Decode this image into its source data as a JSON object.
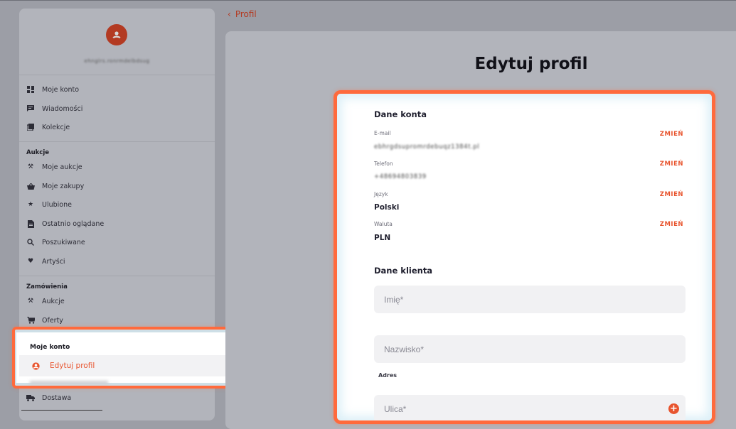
{
  "sidebar": {
    "email": "ehnglrs.ronrmdelbdsug",
    "items_top": [
      {
        "label": "Moje konto",
        "icon": "dashboard-icon"
      },
      {
        "label": "Wiadomości",
        "icon": "message-icon"
      },
      {
        "label": "Kolekcje",
        "icon": "collection-icon"
      }
    ],
    "auctions_title": "Aukcje",
    "items_auctions": [
      {
        "label": "Moje aukcje",
        "icon": "gavel-icon"
      },
      {
        "label": "Moje zakupy",
        "icon": "basket-icon"
      },
      {
        "label": "Ulubione",
        "icon": "star-icon"
      },
      {
        "label": "Ostatnio oglądane",
        "icon": "document-icon"
      },
      {
        "label": "Poszukiwane",
        "icon": "search-icon"
      },
      {
        "label": "Artyści",
        "icon": "heart-icon"
      }
    ],
    "orders_title": "Zamówienia",
    "items_orders": [
      {
        "label": "Aukcje",
        "icon": "gavel-icon"
      },
      {
        "label": "Oferty",
        "icon": "cart-icon"
      }
    ],
    "account_title": "Moje konto",
    "account_active": "Edytuj profil",
    "items_after": [
      {
        "label": "Dostawa",
        "icon": "truck-icon"
      }
    ]
  },
  "back_link": "Profil",
  "page_title": "Edytuj profil",
  "account_section": {
    "title": "Dane konta",
    "change_label": "ZMIEŃ",
    "fields": [
      {
        "label": "E-mail",
        "value": "ebhrgdsupromrdebuqz1384t.pl",
        "blurred": true
      },
      {
        "label": "Telefon",
        "value": "+48694803839",
        "blurred": true
      },
      {
        "label": "Język",
        "value": "Polski",
        "blurred": false
      },
      {
        "label": "Waluta",
        "value": "PLN",
        "blurred": false
      }
    ]
  },
  "client_section": {
    "title": "Dane klienta",
    "first_name_placeholder": "Imię*",
    "last_name_placeholder": "Nazwisko*",
    "address_label": "Adres",
    "street_placeholder": "Ulica*"
  },
  "colors": {
    "accent": "#e8542e",
    "highlight": "#ff6a3c",
    "avatar": "#b33a22"
  }
}
